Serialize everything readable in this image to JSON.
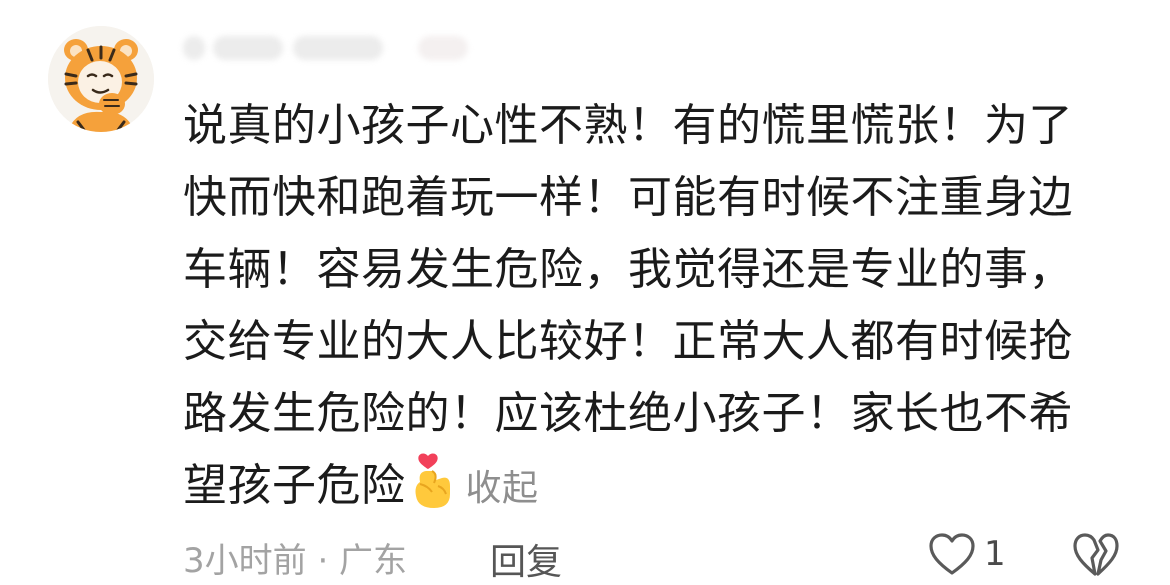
{
  "comment": {
    "text_lines": [
      "说真的小孩子心性不熟！有的慌里慌张！为了",
      "快而快和跑着玩一样！可能有时候不注重身边",
      "车辆！容易发生危险，我觉得还是专业的事，",
      "交给专业的大人比较好！正常大人都有时候抢",
      "路发生危险的！应该杜绝小孩子！家长也不希",
      "望孩子危险"
    ],
    "emoji": "finger-heart-emoji",
    "collapse_label": "收起",
    "meta": "3小时前 · 广东",
    "reply_label": "回复",
    "like_count": "1",
    "avatar_icon": "tiger-avatar-icon",
    "like_icon": "heart-outline-icon",
    "dislike_icon": "broken-heart-icon"
  }
}
